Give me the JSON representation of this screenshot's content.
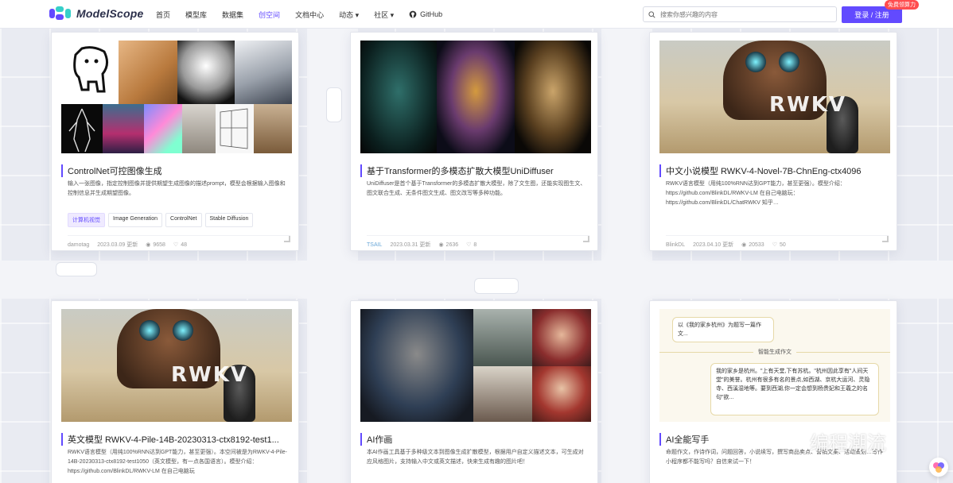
{
  "header": {
    "logo_text": "ModelScope",
    "nav": [
      "首页",
      "模型库",
      "数据集",
      "创空间",
      "文档中心",
      "动态 ▾",
      "社区 ▾",
      "GitHub"
    ],
    "active_nav": "创空间",
    "search_placeholder": "搜索你感兴趣的内容",
    "login_label": "登录 / 注册",
    "badge_label": "免费领算力",
    "accent_color": "#624aff"
  },
  "cards": [
    {
      "title": "ControlNet可控图像生成",
      "description": "输入一张图像，指定控制图像并提供期望生成图像的描述prompt，模型会根据输入图像和控制信息并生成期望图像。",
      "tags": [
        "计算机视觉",
        "Image Generation",
        "ControlNet",
        "Stable Diffusion"
      ],
      "author": "damotag",
      "date": "2023.03.09 更新",
      "views": "9658",
      "likes": "48"
    },
    {
      "title": "基于Transformer的多模态扩散大模型UniDiffuser",
      "description": "UniDiffuser是首个基于Transformer的多模态扩散大模型，除了文生图，还能实现图生文、图文联合生成、无条件图文生成、图文改写等多种功能。",
      "tags": [],
      "author": "TSAIL",
      "date": "2023.03.31 更新",
      "views": "2636",
      "likes": "8"
    },
    {
      "title": "中文小说模型 RWKV-4-Novel-7B-ChnEng-ctx4096",
      "description": "RWKV语言模型（用纯100%RNN达到GPT能力，甚至更强）。模型介绍：https://github.com/BlinkDL/RWKV-LM 在自己电脑玩：https://github.com/BlinkDL/ChatRWKV 知乎…",
      "tags": [],
      "author": "BlinkDL",
      "date": "2023.04.10 更新",
      "views": "20533",
      "likes": "50"
    },
    {
      "title": "英文模型 RWKV-4-Pile-14B-20230313-ctx8192-test1...",
      "description": "RWKV语言模型（用纯100%RNN达到GPT能力，甚至更强）。本空间被是为RWKV-4-Pile-14B-20230313-ctx8192-test1050（英文模型，有一点各国语言）。模型介绍：https://github.com/BlinkDL/RWKV-LM 在自己电脑玩",
      "tags": [],
      "author": "",
      "date": "",
      "views": "",
      "likes": ""
    },
    {
      "title": "AI作画",
      "description": "本AI作画工具基于多种级文本到图像生成扩散模型，根据用户自定义描述文本，可生成对应风格图片，支持输入中文或英文描述，快来生成有趣的图片吧！",
      "tags": [],
      "author": "",
      "date": "",
      "views": "",
      "likes": ""
    },
    {
      "title": "AI全能写手",
      "description": "命题作文，作诗作词，问题回答，小说续写，撰写商品卖点、营销文案、活动策划…写作小程序都不能写吗？自信来试一下！",
      "tags": [],
      "author": "",
      "date": "",
      "views": "",
      "likes": ""
    }
  ],
  "image_text": {
    "rwkv_logo": "RWKV",
    "chat_prompt": "以《我的家乡杭州》为题写一篇作文...",
    "chat_status": "智能生成作文",
    "chat_answer": "我的家乡是杭州。\"上有天堂,下有苏杭。\"杭州因此享有\"人间天堂\"的美誉。杭州有很多有名的景点,如西湖、京杭大运河、灵隐寺、西溪湿地等。要到西湖,你一定会想到杨贵妃和王羲之的名句\"欲..."
  },
  "watermark": "编程潮流"
}
